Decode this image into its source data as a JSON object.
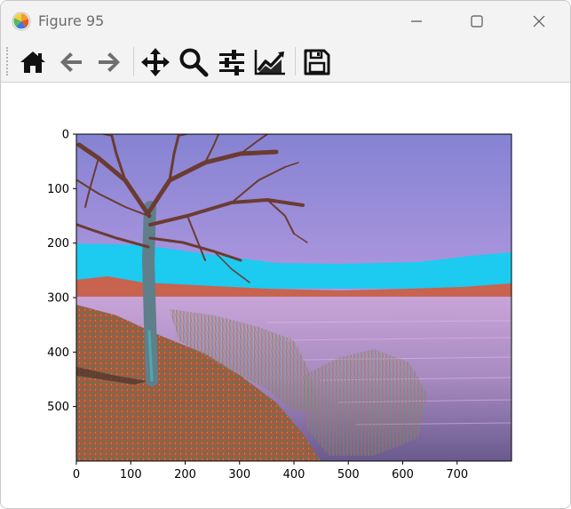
{
  "window": {
    "title": "Figure 95",
    "app_icon": "matplotlib-icon",
    "controls": [
      "minimize-icon",
      "maximize-icon",
      "close-icon"
    ]
  },
  "toolbar": {
    "buttons": [
      {
        "name": "home",
        "icon": "home-icon"
      },
      {
        "name": "back",
        "icon": "arrow-left-icon"
      },
      {
        "name": "forward",
        "icon": "arrow-right-icon"
      },
      {
        "name": "pan",
        "icon": "move-icon"
      },
      {
        "name": "zoom",
        "icon": "magnifier-icon"
      },
      {
        "name": "configure-subplots",
        "icon": "sliders-icon"
      },
      {
        "name": "edit-axes",
        "icon": "line-chart-icon"
      },
      {
        "name": "save",
        "icon": "floppy-disk-icon"
      }
    ]
  },
  "plot": {
    "type": "image",
    "image_width": 800,
    "image_height": 600,
    "x_ticks": [
      "0",
      "100",
      "200",
      "300",
      "400",
      "500",
      "600",
      "700"
    ],
    "y_ticks": [
      "0",
      "100",
      "200",
      "300",
      "400",
      "500"
    ],
    "colors": {
      "sky_top": "#8583d3",
      "sky_mid": "#b69ae0",
      "sky_low": "#e6a8e8",
      "haze": "#1dcaf0",
      "shore_trees": "#c8634f",
      "water": "#a68ac0",
      "water_dark": "#6a5a8e",
      "grass": "#a55a3e",
      "grass_green": "#2d8c6a",
      "trunk": "#5f7f8a",
      "branches": "#6b3b32"
    }
  }
}
